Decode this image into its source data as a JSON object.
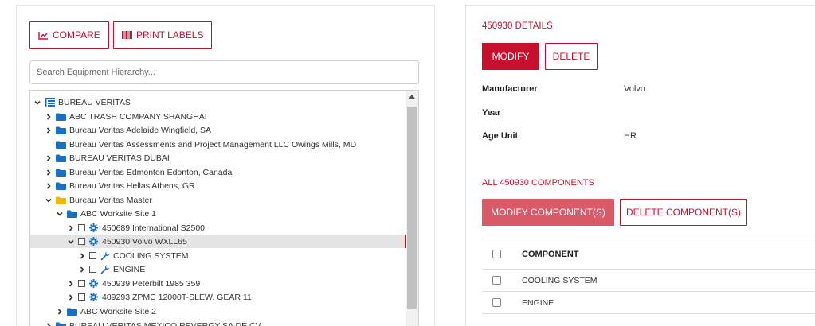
{
  "colors": {
    "accent": "#c8102e",
    "accent_light": "#db5a6a",
    "folder_blue": "#1a6fc2",
    "folder_yellow": "#f2b705",
    "selected_row": "#e4e4e4"
  },
  "toolbar": {
    "compare_label": "COMPARE",
    "compare_icon": "chart-icon",
    "print_labels_label": "PRINT LABELS",
    "print_labels_icon": "barcode-icon"
  },
  "search": {
    "placeholder": "Search Equipment Hierarchy..."
  },
  "tree": {
    "rows": [
      {
        "label": "BUREAU VERITAS",
        "chevron": "down",
        "icon": "hierarchy-icon",
        "checkbox": false,
        "selected": false,
        "color": "#c8102e"
      },
      {
        "label": "ABC TRASH COMPANY SHANGHAI",
        "chevron": "right",
        "icon": "folder-icon",
        "checkbox": false,
        "selected": false
      },
      {
        "label": "Bureau Veritas Adelaide Wingfield, SA",
        "chevron": "right",
        "icon": "folder-icon",
        "checkbox": false,
        "selected": false
      },
      {
        "label": "Bureau Veritas Assessments and Project Management LLC Owings Mills, MD",
        "chevron": "none",
        "icon": "folder-icon",
        "checkbox": false,
        "selected": false
      },
      {
        "label": "BUREAU VERITAS DUBAI",
        "chevron": "right",
        "icon": "folder-icon",
        "checkbox": false,
        "selected": false
      },
      {
        "label": "Bureau Veritas Edmonton Edonton, Canada",
        "chevron": "right",
        "icon": "folder-icon",
        "checkbox": false,
        "selected": false
      },
      {
        "label": "Bureau Veritas Hellas Athens, GR",
        "chevron": "right",
        "icon": "folder-icon",
        "checkbox": false,
        "selected": false
      },
      {
        "label": "Bureau Veritas Master",
        "chevron": "down",
        "icon": "folder-open-icon",
        "checkbox": false,
        "selected": false
      },
      {
        "label": "ABC Worksite Site 1",
        "chevron": "down",
        "icon": "folder-icon",
        "checkbox": false,
        "selected": false
      },
      {
        "label": "450689 International S2500",
        "chevron": "right",
        "icon": "gear-icon",
        "checkbox": true,
        "selected": false
      },
      {
        "label": "450930 Volvo WXLL65",
        "chevron": "down",
        "icon": "gear-icon",
        "checkbox": true,
        "selected": true
      },
      {
        "label": "COOLING SYSTEM",
        "chevron": "right",
        "icon": "wrench-icon",
        "checkbox": true,
        "selected": false
      },
      {
        "label": "ENGINE",
        "chevron": "right",
        "icon": "wrench-icon",
        "checkbox": true,
        "selected": false
      },
      {
        "label": "450939 Peterbilt 1985 359",
        "chevron": "right",
        "icon": "gear-icon",
        "checkbox": true,
        "selected": false
      },
      {
        "label": "489293 ZPMC 12000T-SLEW. GEAR 11",
        "chevron": "right",
        "icon": "gear-icon",
        "checkbox": true,
        "selected": false
      },
      {
        "label": "ABC Worksite Site 2",
        "chevron": "right",
        "icon": "folder-icon",
        "checkbox": false,
        "selected": false
      },
      {
        "label": "BUREAU VERITAS MEXICO REVERGY SA DE CV",
        "chevron": "right",
        "icon": "folder-icon",
        "checkbox": false,
        "selected": false
      }
    ]
  },
  "details": {
    "title": "450930 DETAILS",
    "modify_label": "MODIFY",
    "delete_label": "DELETE",
    "fields": [
      {
        "label": "Manufacturer",
        "value": "Volvo"
      },
      {
        "label": "Year",
        "value": ""
      },
      {
        "label": "Age Unit",
        "value": "HR"
      }
    ]
  },
  "components": {
    "title": "ALL 450930 COMPONENTS",
    "modify_label": "MODIFY COMPONENT(S)",
    "delete_label": "DELETE COMPONENT(S)",
    "column_header": "COMPONENT",
    "rows": [
      "COOLING SYSTEM",
      "ENGINE"
    ]
  }
}
